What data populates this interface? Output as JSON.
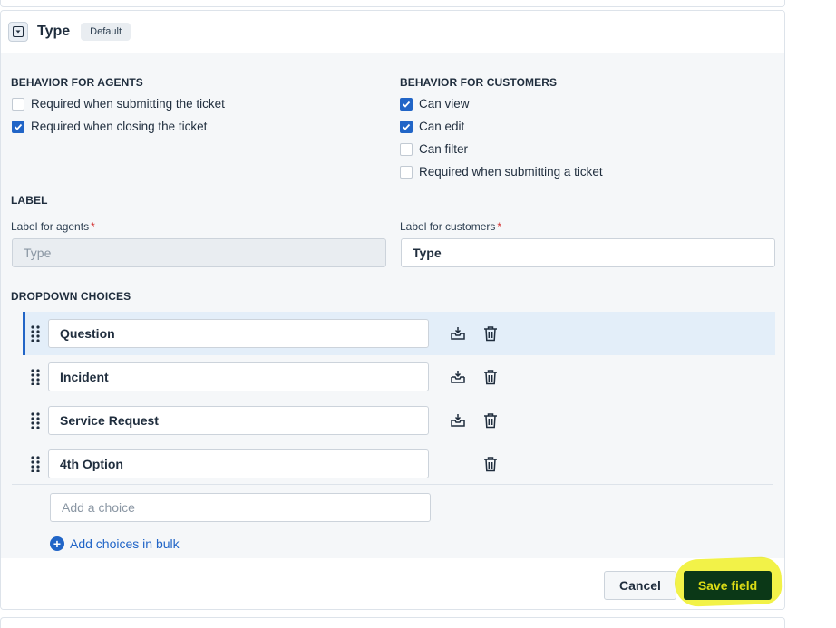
{
  "header": {
    "title": "Type",
    "badge": "Default",
    "icon": "dropdown-icon"
  },
  "agents": {
    "title": "BEHAVIOR FOR AGENTS",
    "options": [
      {
        "label": "Required when submitting the ticket",
        "checked": false
      },
      {
        "label": "Required when closing the ticket",
        "checked": true
      }
    ]
  },
  "customers": {
    "title": "BEHAVIOR FOR CUSTOMERS",
    "options": [
      {
        "label": "Can view",
        "checked": true
      },
      {
        "label": "Can edit",
        "checked": true
      },
      {
        "label": "Can filter",
        "checked": false
      },
      {
        "label": "Required when submitting a ticket",
        "checked": false
      }
    ]
  },
  "label_section": {
    "title": "LABEL",
    "agents_label": "Label for agents",
    "agents_placeholder": "Type",
    "customers_label": "Label for customers",
    "customers_value": "Type",
    "required_mark": "*"
  },
  "dropdown": {
    "title": "DROPDOWN CHOICES",
    "choices": [
      {
        "value": "Question",
        "default_icon": true
      },
      {
        "value": "Incident",
        "default_icon": true
      },
      {
        "value": "Service Request",
        "default_icon": true
      },
      {
        "value": "4th Option",
        "default_icon": false
      }
    ],
    "add_placeholder": "Add a choice",
    "bulk_label": "Add choices in bulk"
  },
  "footer": {
    "cancel_label": "Cancel",
    "save_label": "Save field"
  },
  "colors": {
    "accent": "#2165c7",
    "save_bg": "#0b3b4f",
    "highlight": "#f0f028"
  }
}
